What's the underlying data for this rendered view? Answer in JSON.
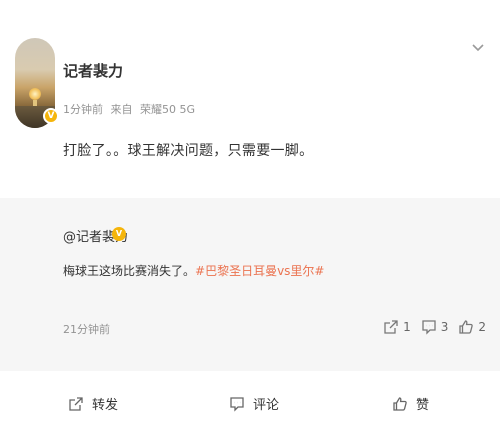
{
  "post": {
    "username": "记者裴力",
    "time": "1分钟前",
    "source_prefix": "来自",
    "source_device": "荣耀50 5G",
    "text": "打脸了。。球王解决问题，只需要一脚。"
  },
  "repost": {
    "username": "@记者裴力",
    "text_plain": "梅球王这场比赛消失了。",
    "topic": "#巴黎圣日耳曼vs里尔#",
    "time": "21分钟前",
    "stats": {
      "reposts": "1",
      "comments": "3",
      "likes": "2"
    }
  },
  "toolbar": {
    "repost_label": "转发",
    "comment_label": "评论",
    "like_label": "赞"
  },
  "colors": {
    "verify_badge": "#f5b50b",
    "topic_link": "#eb7350",
    "repost_bg": "#f6f6f6",
    "muted_text": "#939393"
  },
  "icons": {
    "menu": "chevron-down-icon",
    "verified": "verified-badge-icon",
    "repost": "repost-icon",
    "comment": "comment-icon",
    "like": "thumbs-up-icon"
  }
}
